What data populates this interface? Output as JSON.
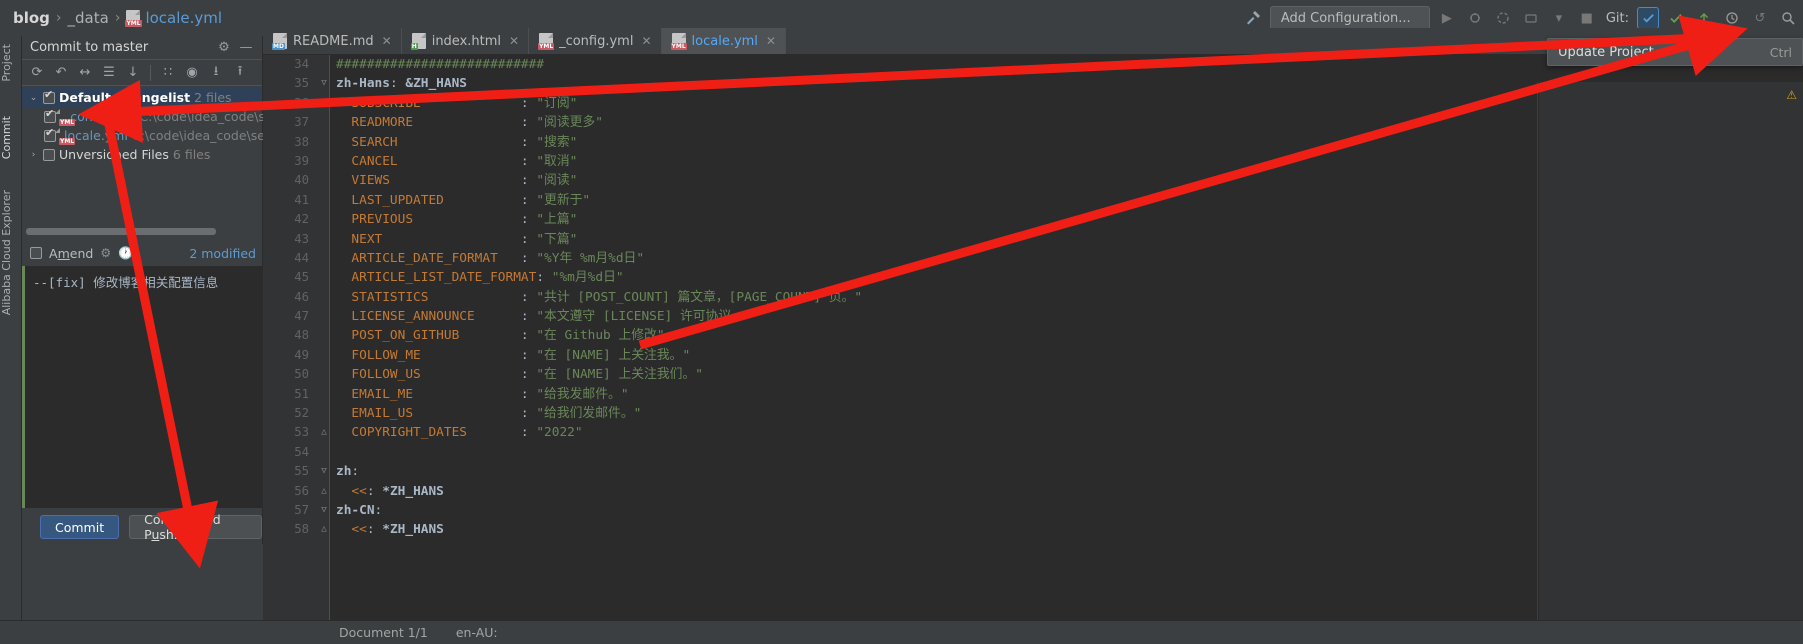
{
  "breadcrumb": {
    "items": [
      {
        "label": "blog",
        "style": "bold",
        "icon": ""
      },
      {
        "label": "_data",
        "style": "normal",
        "icon": ""
      },
      {
        "label": "locale.yml",
        "style": "link",
        "icon": "yml-file-icon"
      }
    ],
    "separator": "›"
  },
  "navbar_right": {
    "build_icon": "hammer-icon",
    "run_config_label": "Add Configuration...",
    "run_icon": "run-icon",
    "debug_icon": "debug-icon",
    "coverage_icon": "run-with-coverage-icon",
    "profile_icon": "profile-icon",
    "stop_icon": "stop-icon",
    "git_label": "Git:",
    "git_update_icon": "update-project-icon",
    "git_commit_icon": "commit-icon",
    "git_push_icon": "push-icon",
    "git_history_icon": "history-icon",
    "git_rollback_icon": "rollback-icon",
    "search_icon": "search-icon"
  },
  "update_popup": {
    "title": "Update Project...",
    "shortcut": "Ctrl"
  },
  "left_tool_strip": {
    "tabs": [
      "Project",
      "Commit",
      "Alibaba Cloud Explorer"
    ]
  },
  "commit_window": {
    "title": "Commit to master",
    "settings_icon": "gear-icon",
    "minimize_icon": "minimize-icon",
    "toolbar": [
      {
        "name": "refresh-changes-icon",
        "glyph": "⟳"
      },
      {
        "name": "rollback-icon",
        "glyph": "↶"
      },
      {
        "name": "show-diff-icon",
        "glyph": "↔"
      },
      {
        "name": "group-by-icon",
        "glyph": "☰"
      },
      {
        "name": "update-icon",
        "glyph": "↓"
      },
      {
        "name": "group-by-directory-icon",
        "glyph": "∷"
      },
      {
        "name": "preview-diff-icon",
        "glyph": "◉"
      },
      {
        "name": "expand-all-icon",
        "glyph": "⭳"
      },
      {
        "name": "collapse-all-icon",
        "glyph": "⭱"
      }
    ],
    "tree": [
      {
        "name": "changelist-row",
        "arrow": "⌄",
        "checked": true,
        "selected": true,
        "label": "Default Changelist",
        "sub": "2 files",
        "indent": 0,
        "icon": ""
      },
      {
        "name": "changed-file-row",
        "arrow": "",
        "checked": true,
        "selected": false,
        "label": "_config.yml",
        "sub": "C:\\code\\idea_code\\self_",
        "indent": 1,
        "icon": "yml-file-icon"
      },
      {
        "name": "changed-file-row",
        "arrow": "",
        "checked": true,
        "selected": false,
        "label": "locale.yml",
        "sub": "C:\\code\\idea_code\\self_",
        "indent": 1,
        "icon": "yml-file-icon"
      },
      {
        "name": "unversioned-files-row",
        "arrow": "›",
        "checked": false,
        "selected": false,
        "label": "Unversioned Files",
        "sub": "6 files",
        "indent": 0,
        "icon": ""
      }
    ],
    "amend_label_pre": "A",
    "amend_label_key": "m",
    "amend_label_post": "end",
    "amend_checked": false,
    "amend_gear_icon": "gear-icon",
    "amend_history_icon": "history-clock-icon",
    "modified_count": "2 modified",
    "commit_message": "--[fix] 修改博客相关配置信息",
    "commit_button": "Commit",
    "commit_and_push_pre": "Commit and P",
    "commit_and_push_key": "u",
    "commit_and_push_post": "sh..."
  },
  "editor_tabs": [
    {
      "label": "README.md",
      "icon": "md-file-icon",
      "tag": "MD",
      "active": false
    },
    {
      "label": "index.html",
      "icon": "html-file-icon",
      "tag": "H",
      "active": false
    },
    {
      "label": "_config.yml",
      "icon": "yml-file-icon",
      "tag": "YML",
      "active": false
    },
    {
      "label": "locale.yml",
      "icon": "yml-file-icon",
      "tag": "YML",
      "active": true
    }
  ],
  "editor": {
    "first_line_number": 34,
    "lines": [
      {
        "n": 34,
        "fold": "",
        "tokens": [
          {
            "t": "###########################",
            "c": "k-cmt"
          }
        ]
      },
      {
        "n": 35,
        "fold": "▽",
        "tokens": [
          {
            "t": "zh-Hans",
            "c": "k-anch"
          },
          {
            "t": ": ",
            "c": "k-punc"
          },
          {
            "t": "&ZH_HANS",
            "c": "k-anch"
          }
        ]
      },
      {
        "n": 36,
        "fold": "",
        "tokens": [
          {
            "t": "  SUBSCRIBE             ",
            "c": "k-key"
          },
          {
            "t": ": ",
            "c": "k-punc"
          },
          {
            "t": "\"订阅\"",
            "c": "k-str"
          }
        ]
      },
      {
        "n": 37,
        "fold": "",
        "tokens": [
          {
            "t": "  READMORE              ",
            "c": "k-key"
          },
          {
            "t": ": ",
            "c": "k-punc"
          },
          {
            "t": "\"阅读更多\"",
            "c": "k-str"
          }
        ]
      },
      {
        "n": 38,
        "fold": "",
        "tokens": [
          {
            "t": "  SEARCH                ",
            "c": "k-key"
          },
          {
            "t": ": ",
            "c": "k-punc"
          },
          {
            "t": "\"搜索\"",
            "c": "k-str"
          }
        ]
      },
      {
        "n": 39,
        "fold": "",
        "tokens": [
          {
            "t": "  CANCEL                ",
            "c": "k-key"
          },
          {
            "t": ": ",
            "c": "k-punc"
          },
          {
            "t": "\"取消\"",
            "c": "k-str"
          }
        ]
      },
      {
        "n": 40,
        "fold": "",
        "tokens": [
          {
            "t": "  VIEWS                 ",
            "c": "k-key"
          },
          {
            "t": ": ",
            "c": "k-punc"
          },
          {
            "t": "\"阅读\"",
            "c": "k-str"
          }
        ]
      },
      {
        "n": 41,
        "fold": "",
        "tokens": [
          {
            "t": "  LAST_UPDATED          ",
            "c": "k-key"
          },
          {
            "t": ": ",
            "c": "k-punc"
          },
          {
            "t": "\"更新于\"",
            "c": "k-str"
          }
        ]
      },
      {
        "n": 42,
        "fold": "",
        "tokens": [
          {
            "t": "  PREVIOUS              ",
            "c": "k-key"
          },
          {
            "t": ": ",
            "c": "k-punc"
          },
          {
            "t": "\"上篇\"",
            "c": "k-str"
          }
        ]
      },
      {
        "n": 43,
        "fold": "",
        "tokens": [
          {
            "t": "  NEXT                  ",
            "c": "k-key"
          },
          {
            "t": ": ",
            "c": "k-punc"
          },
          {
            "t": "\"下篇\"",
            "c": "k-str"
          }
        ]
      },
      {
        "n": 44,
        "fold": "",
        "tokens": [
          {
            "t": "  ARTICLE_DATE_FORMAT   ",
            "c": "k-key"
          },
          {
            "t": ": ",
            "c": "k-punc"
          },
          {
            "t": "\"%Y年 %m月%d日\"",
            "c": "k-str"
          }
        ]
      },
      {
        "n": 45,
        "fold": "",
        "tokens": [
          {
            "t": "  ARTICLE_LIST_DATE_FORMAT",
            "c": "k-key"
          },
          {
            "t": ": ",
            "c": "k-punc"
          },
          {
            "t": "\"%m月%d日\"",
            "c": "k-str"
          }
        ]
      },
      {
        "n": 46,
        "fold": "",
        "tokens": [
          {
            "t": "  STATISTICS            ",
            "c": "k-key"
          },
          {
            "t": ": ",
            "c": "k-punc"
          },
          {
            "t": "\"共计 [POST_COUNT] 篇文章，[PAGE_COUNT] 页。\"",
            "c": "k-str"
          }
        ]
      },
      {
        "n": 47,
        "fold": "",
        "tokens": [
          {
            "t": "  LICENSE_ANNOUNCE      ",
            "c": "k-key"
          },
          {
            "t": ": ",
            "c": "k-punc"
          },
          {
            "t": "\"本文遵守 [LICENSE] 许可协议。\"",
            "c": "k-str"
          }
        ]
      },
      {
        "n": 48,
        "fold": "",
        "tokens": [
          {
            "t": "  POST_ON_GITHUB        ",
            "c": "k-key"
          },
          {
            "t": ": ",
            "c": "k-punc"
          },
          {
            "t": "\"在 Github 上修改\"",
            "c": "k-str"
          }
        ]
      },
      {
        "n": 49,
        "fold": "",
        "tokens": [
          {
            "t": "  FOLLOW_ME             ",
            "c": "k-key"
          },
          {
            "t": ": ",
            "c": "k-punc"
          },
          {
            "t": "\"在 [NAME] 上关注我。\"",
            "c": "k-str"
          }
        ]
      },
      {
        "n": 50,
        "fold": "",
        "tokens": [
          {
            "t": "  FOLLOW_US             ",
            "c": "k-key"
          },
          {
            "t": ": ",
            "c": "k-punc"
          },
          {
            "t": "\"在 [NAME] 上关注我们。\"",
            "c": "k-str"
          }
        ]
      },
      {
        "n": 51,
        "fold": "",
        "tokens": [
          {
            "t": "  EMAIL_ME              ",
            "c": "k-key"
          },
          {
            "t": ": ",
            "c": "k-punc"
          },
          {
            "t": "\"给我发邮件。\"",
            "c": "k-str"
          }
        ]
      },
      {
        "n": 52,
        "fold": "",
        "tokens": [
          {
            "t": "  EMAIL_US              ",
            "c": "k-key"
          },
          {
            "t": ": ",
            "c": "k-punc"
          },
          {
            "t": "\"给我们发邮件。\"",
            "c": "k-str"
          }
        ]
      },
      {
        "n": 53,
        "fold": "△",
        "tokens": [
          {
            "t": "  COPYRIGHT_DATES       ",
            "c": "k-key"
          },
          {
            "t": ": ",
            "c": "k-punc"
          },
          {
            "t": "\"2022\"",
            "c": "k-str"
          }
        ]
      },
      {
        "n": 54,
        "fold": "",
        "tokens": [
          {
            "t": "",
            "c": "k-txt"
          }
        ]
      },
      {
        "n": 55,
        "fold": "▽",
        "tokens": [
          {
            "t": "zh",
            "c": "k-anch"
          },
          {
            "t": ":",
            "c": "k-punc"
          }
        ]
      },
      {
        "n": 56,
        "fold": "△",
        "tokens": [
          {
            "t": "  <<",
            "c": "k-key"
          },
          {
            "t": ": ",
            "c": "k-punc"
          },
          {
            "t": "*ZH_HANS",
            "c": "k-anch"
          }
        ]
      },
      {
        "n": 57,
        "fold": "▽",
        "tokens": [
          {
            "t": "zh-CN",
            "c": "k-anch"
          },
          {
            "t": ":",
            "c": "k-punc"
          }
        ]
      },
      {
        "n": 58,
        "fold": "△",
        "tokens": [
          {
            "t": "  <<",
            "c": "k-key"
          },
          {
            "t": ": ",
            "c": "k-punc"
          },
          {
            "t": "*ZH_HANS",
            "c": "k-anch"
          }
        ]
      }
    ]
  },
  "status_bar": {
    "document_position": "Document 1/1",
    "locale": "en-AU:"
  },
  "colors": {
    "accent_blue": "#4a88c7",
    "annotation_red": "#f01f16",
    "editor_bg": "#2b2b2b",
    "chrome_bg": "#3c3f41",
    "key_orange": "#c57a33",
    "string_green": "#6a8759",
    "link_blue": "#6897bb"
  },
  "annotations": {
    "arrows": [
      {
        "name": "arrow-to-changelist",
        "desc": "long arrow from top-right toolbar to Default Changelist"
      },
      {
        "name": "arrow-to-commit-button",
        "desc": "arrow from commit message area down to Commit button"
      },
      {
        "name": "arrow-to-git-update",
        "desc": "arrow from editor center up-right to Git update icon"
      }
    ]
  }
}
